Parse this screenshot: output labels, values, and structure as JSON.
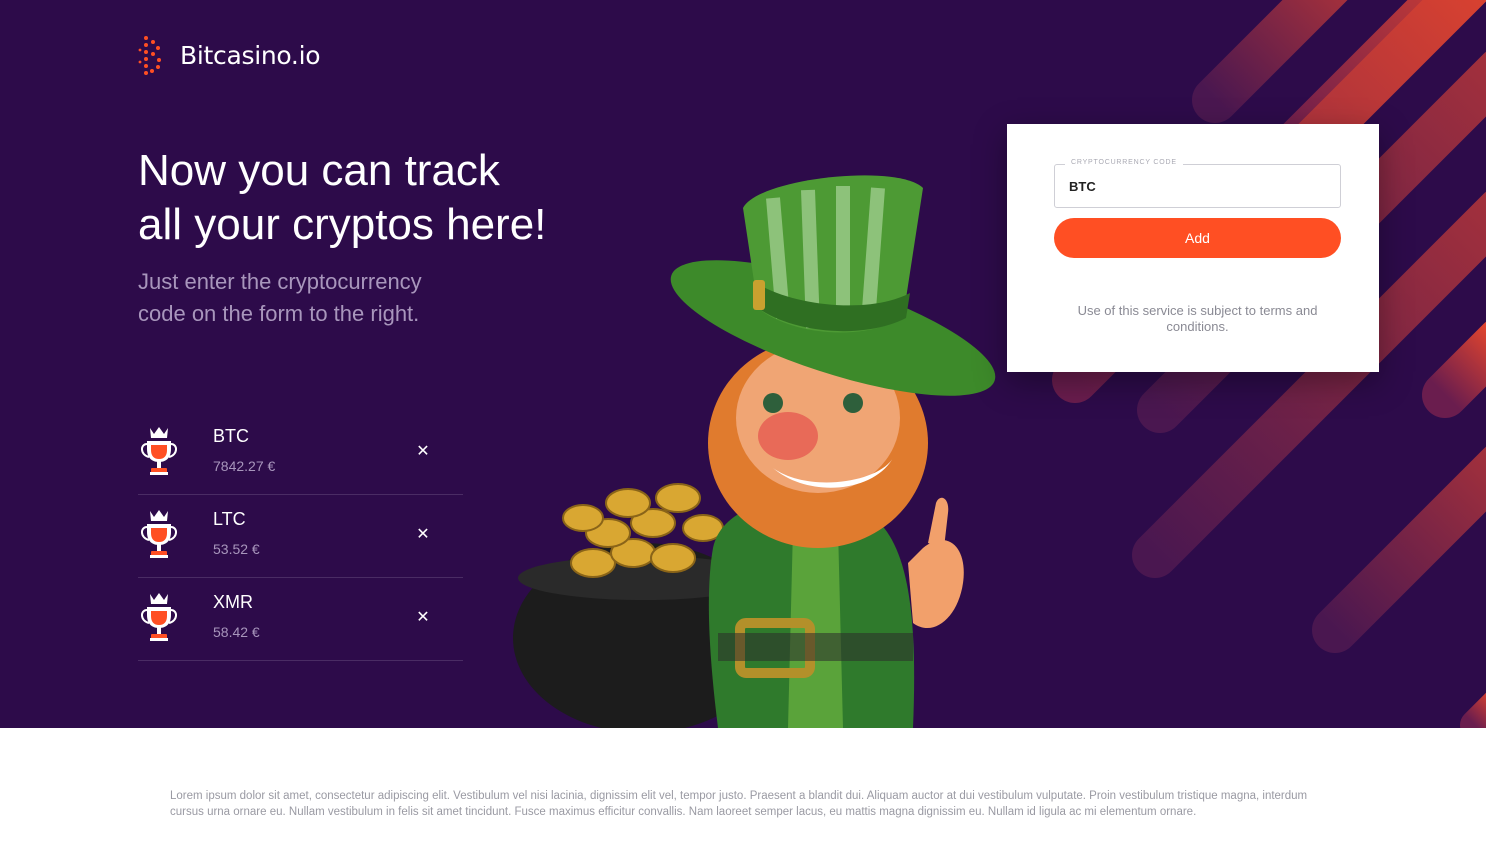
{
  "brand": {
    "name": "Bitcasino.io",
    "accent_color": "#ff4f23",
    "background_color": "#2d0b4a"
  },
  "hero": {
    "headline_line1": "Now you can track",
    "headline_line2": "all your cryptos here!",
    "subline": "Just enter the cryptocurrency code on the form to the right."
  },
  "tracked": [
    {
      "code": "BTC",
      "price": "7842.27 €",
      "icon": "trophy-icon",
      "remove_icon": "close-icon"
    },
    {
      "code": "LTC",
      "price": "53.52 €",
      "icon": "trophy-icon",
      "remove_icon": "close-icon"
    },
    {
      "code": "XMR",
      "price": "58.42 €",
      "icon": "trophy-icon",
      "remove_icon": "close-icon"
    }
  ],
  "form": {
    "field_label": "CRYPTOCURRENCY CODE",
    "field_value": "BTC",
    "add_label": "Add",
    "terms": "Use of this service is subject to terms and conditions."
  },
  "footer": {
    "text": "Lorem ipsum dolor sit amet, consectetur adipiscing elit. Vestibulum vel nisi lacinia, dignissim elit vel, tempor justo. Praesent a blandit dui. Aliquam auctor at dui vestibulum vulputate. Proin vestibulum tristique magna, interdum cursus urna ornare eu. Nullam vestibulum in felis sit amet tincidunt. Fusce maximus efficitur convallis. Nam laoreet semper lacus, eu mattis magna dignissim eu. Nullam id ligula ac mi elementum ornare."
  }
}
